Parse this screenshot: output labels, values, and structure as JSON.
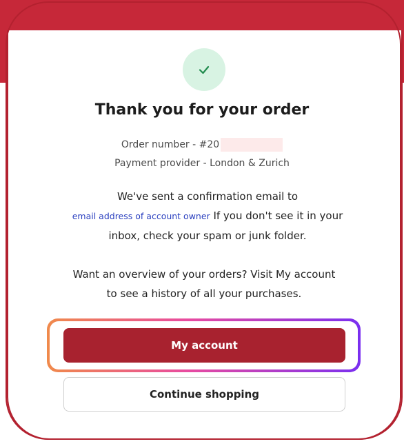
{
  "confirmation": {
    "title": "Thank you for your order",
    "order_number": "Order number - #20",
    "payment_provider": "Payment provider - London & Zurich",
    "email_intro": "We've sent a confirmation email to",
    "email_address": "email address of account owner",
    "email_after": " If you don't see it in your inbox, check your spam or junk folder.",
    "overview_text": "Want an overview of your orders? Visit My account to see a history of all your purchases."
  },
  "actions": {
    "my_account_label": "My account",
    "continue_shopping_label": "Continue shopping"
  },
  "icons": {
    "success": "check-icon"
  },
  "colors": {
    "brand_red": "#c62839",
    "primary_button": "#a8222f",
    "success_bg": "#d8f3e3",
    "success_check": "#1f8a4c",
    "link_blue": "#2a3fbf"
  }
}
